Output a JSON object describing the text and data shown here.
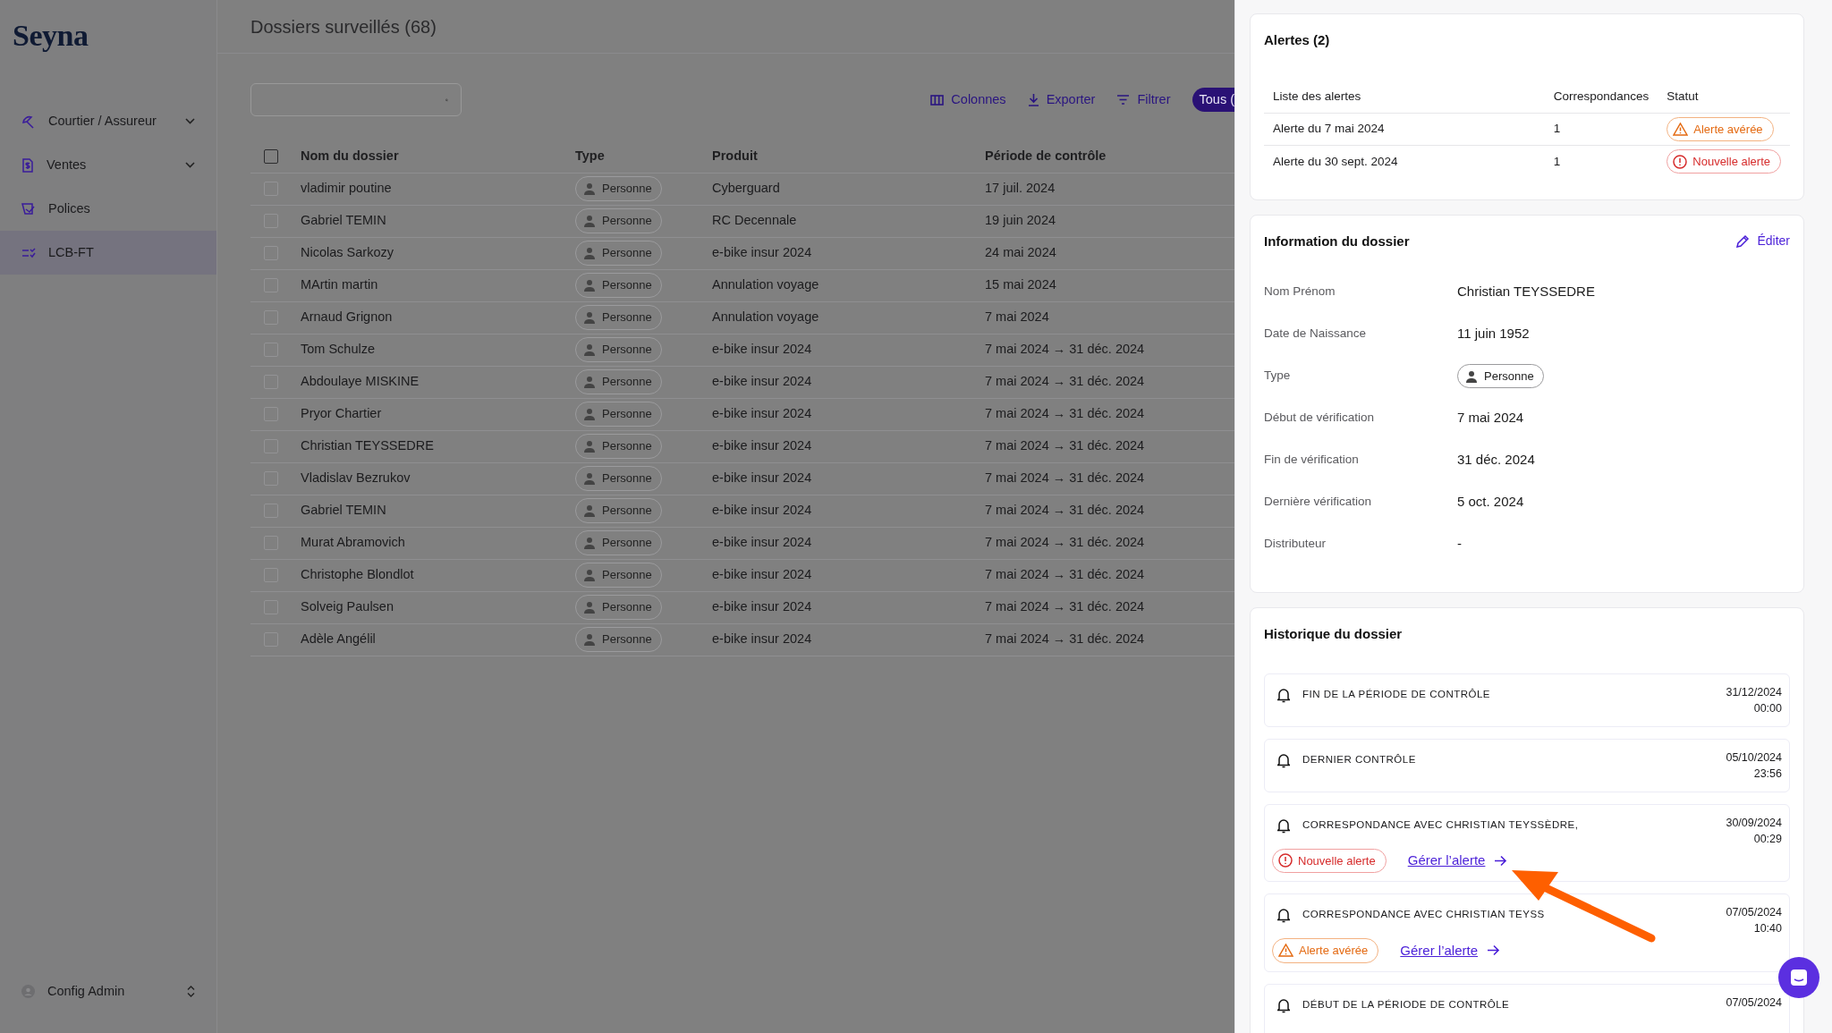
{
  "sidebar": {
    "logo": "Seyna",
    "items": [
      {
        "label": "Courtier / Assureur",
        "expandable": true,
        "selected": false
      },
      {
        "label": "Ventes",
        "expandable": true,
        "selected": false
      },
      {
        "label": "Polices",
        "expandable": false,
        "selected": false
      },
      {
        "label": "LCB-FT",
        "expandable": false,
        "selected": true
      }
    ],
    "user": "Config Admin"
  },
  "header": {
    "title": "Dossiers surveillés (68)"
  },
  "toolbar": {
    "actions": [
      "Colonnes",
      "Exporter",
      "Filtrer"
    ],
    "filter_chip": "Tous ("
  },
  "table": {
    "select_all_checked": false,
    "columns": [
      "Nom du dossier",
      "Type",
      "Produit",
      "Période de contrôle"
    ],
    "rows": [
      {
        "name": "vladimir poutine",
        "type": "Personne",
        "product": "Cyberguard",
        "period": "17 juil. 2024",
        "checked": false
      },
      {
        "name": "Gabriel TEMIN",
        "type": "Personne",
        "product": "RC Decennale",
        "period": "19 juin 2024",
        "checked": false
      },
      {
        "name": "Nicolas Sarkozy",
        "type": "Personne",
        "product": "e-bike insur 2024",
        "period": "24 mai 2024",
        "checked": false
      },
      {
        "name": "MArtin martin",
        "type": "Personne",
        "product": "Annulation voyage",
        "period": "15 mai 2024",
        "checked": false
      },
      {
        "name": "Arnaud Grignon",
        "type": "Personne",
        "product": "Annulation voyage",
        "period": "7 mai 2024",
        "checked": false
      },
      {
        "name": "Tom Schulze",
        "type": "Personne",
        "product": "e-bike insur 2024",
        "period": "7 mai 2024 → 31 déc. 2024",
        "checked": false
      },
      {
        "name": "Abdoulaye MISKINE",
        "type": "Personne",
        "product": "e-bike insur 2024",
        "period": "7 mai 2024 → 31 déc. 2024",
        "checked": false
      },
      {
        "name": "Pryor Chartier",
        "type": "Personne",
        "product": "e-bike insur 2024",
        "period": "7 mai 2024 → 31 déc. 2024",
        "checked": false
      },
      {
        "name": "Christian TEYSSEDRE",
        "type": "Personne",
        "product": "e-bike insur 2024",
        "period": "7 mai 2024 → 31 déc. 2024",
        "checked": false
      },
      {
        "name": "Vladislav Bezrukov",
        "type": "Personne",
        "product": "e-bike insur 2024",
        "period": "7 mai 2024 → 31 déc. 2024",
        "checked": false
      },
      {
        "name": "Gabriel TEMIN",
        "type": "Personne",
        "product": "e-bike insur 2024",
        "period": "7 mai 2024 → 31 déc. 2024",
        "checked": false
      },
      {
        "name": "Murat Abramovich",
        "type": "Personne",
        "product": "e-bike insur 2024",
        "period": "7 mai 2024 → 31 déc. 2024",
        "checked": false
      },
      {
        "name": "Christophe Blondlot",
        "type": "Personne",
        "product": "e-bike insur 2024",
        "period": "7 mai 2024 → 31 déc. 2024",
        "checked": false
      },
      {
        "name": "Solveig Paulsen",
        "type": "Personne",
        "product": "e-bike insur 2024",
        "period": "7 mai 2024 → 31 déc. 2024",
        "checked": false
      },
      {
        "name": "Adèle Angélil",
        "type": "Personne",
        "product": "e-bike insur 2024",
        "period": "7 mai 2024 → 31 déc. 2024",
        "checked": false
      }
    ]
  },
  "drawer": {
    "alerts": {
      "title": "Alertes (2)",
      "columns": [
        "Liste des alertes",
        "Correspondances",
        "Statut"
      ],
      "rows": [
        {
          "label": "Alerte du 7 mai 2024",
          "matches": "1",
          "status": {
            "kind": "confirmed",
            "label": "Alerte avérée"
          }
        },
        {
          "label": "Alerte du 30 sept. 2024",
          "matches": "1",
          "status": {
            "kind": "new",
            "label": "Nouvelle alerte"
          }
        }
      ]
    },
    "info": {
      "title": "Information du dossier",
      "edit": "Éditer",
      "fields": [
        {
          "label": "Nom Prénom",
          "value": "Christian TEYSSEDRE",
          "kind": "text"
        },
        {
          "label": "Date de Naissance",
          "value": "11 juin 1952",
          "kind": "text"
        },
        {
          "label": "Type",
          "value": "Personne",
          "kind": "tag"
        },
        {
          "label": "Début de vérification",
          "value": "7 mai 2024",
          "kind": "text"
        },
        {
          "label": "Fin de vérification",
          "value": "31 déc. 2024",
          "kind": "text"
        },
        {
          "label": "Dernière vérification",
          "value": "5 oct. 2024",
          "kind": "text"
        },
        {
          "label": "Distributeur",
          "value": "-",
          "kind": "text"
        }
      ]
    },
    "history": {
      "title": "Historique du dossier",
      "items": [
        {
          "title": "FIN DE LA PÉRIODE DE CONTRÔLE",
          "date": "31/12/2024",
          "time": "00:00"
        },
        {
          "title": "DERNIER CONTRÔLE",
          "date": "05/10/2024",
          "time": "23:56"
        },
        {
          "title": "CORRESPONDANCE AVEC CHRISTIAN TEYSSÈDRE,",
          "date": "30/09/2024",
          "time": "00:29",
          "status": {
            "kind": "new",
            "label": "Nouvelle alerte"
          },
          "link": "Gérer l’alerte"
        },
        {
          "title": "CORRESPONDANCE AVEC CHRISTIAN TEYSS",
          "date": "07/05/2024",
          "time": "10:40",
          "status": {
            "kind": "confirmed",
            "label": "Alerte avérée"
          },
          "link": "Gérer l’alerte"
        },
        {
          "title": "DÉBUT DE LA PÉRIODE DE CONTRÔLE",
          "date": "07/05/2024"
        }
      ]
    }
  }
}
